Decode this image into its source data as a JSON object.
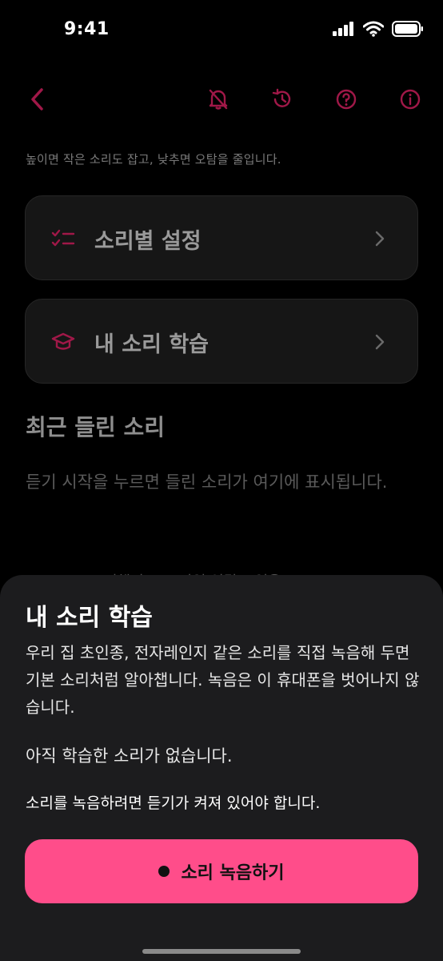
{
  "status": {
    "time": "9:41"
  },
  "nav": {
    "back_icon": "chevron-left-icon",
    "icons": [
      "bell-off-icon",
      "history-icon",
      "help-icon",
      "info-icon"
    ],
    "accent": "#c2185b"
  },
  "main": {
    "hint": "높이면 작은 소리도 잡고, 낮추면 오탐을 줄입니다.",
    "cards": [
      {
        "label": "소리별 설정",
        "icon": "checklist-icon"
      },
      {
        "label": "내 소리 학습",
        "icon": "graduation-cap-icon"
      }
    ],
    "recent_title": "최근 들린 소리",
    "recent_empty": "듣기 시작을 누르면 들린 소리가 여기에 표시됩니다.",
    "partial_chips": "비행기 모드 작업   연결도 없음"
  },
  "sheet": {
    "title": "내 소리 학습",
    "description": "우리 집 초인종, 전자레인지 같은 소리를 직접 녹음해 두면 기본 소리처럼 알아챕니다. 녹음은 이 휴대폰을 벗어나지 않습니다.",
    "empty": "아직 학습한 소리가 없습니다.",
    "notice": "소리를 녹음하려면 듣기가 켜져 있어야 합니다.",
    "record_label": "소리 녹음하기",
    "button_color": "#ff4d8a"
  }
}
